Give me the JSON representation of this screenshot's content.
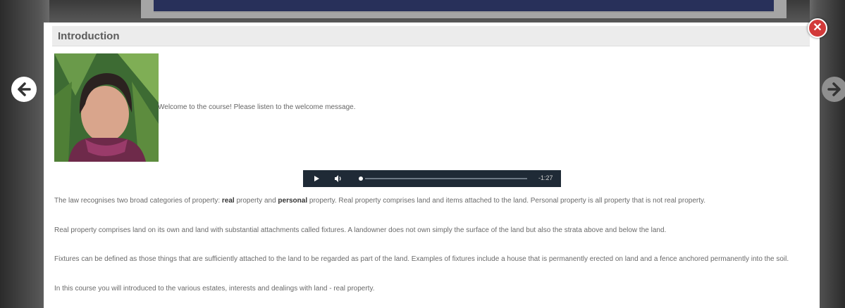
{
  "modal": {
    "title": "Introduction",
    "close_symbol": "✕",
    "welcome_text": "Welcome to the course! Please listen to the welcome message."
  },
  "navigation": {
    "prev_icon": "arrow-left-icon",
    "next_icon": "arrow-right-icon"
  },
  "audio_player": {
    "time": "-1:27",
    "play_icon": "play-icon",
    "volume_icon": "volume-icon"
  },
  "paragraphs": {
    "p1_part1": "The law recognises two broad categories of property: ",
    "p1_real": "real",
    "p1_part2": " property and ",
    "p1_personal": "personal",
    "p1_part3": " property. Real property comprises land and items attached to the land. Personal property is all property that is not real property.",
    "p2": "Real property comprises land on its own and land with substantial attachments called fixtures. A landowner does not own simply the surface of the land but also the strata above and below the land.",
    "p3": "Fixtures can be defined as those things that are sufficiently attached to the land to be regarded as part of the land. Examples of fixtures include a house that is permanently erected on land and a fence anchored permanently into the soil.",
    "p4": "In this course you will introduced to the various estates, interests and dealings with land - real property."
  },
  "colors": {
    "close_button": "#d23a3a",
    "audio_bar": "#1f2a36",
    "header_bg": "#ececec"
  }
}
